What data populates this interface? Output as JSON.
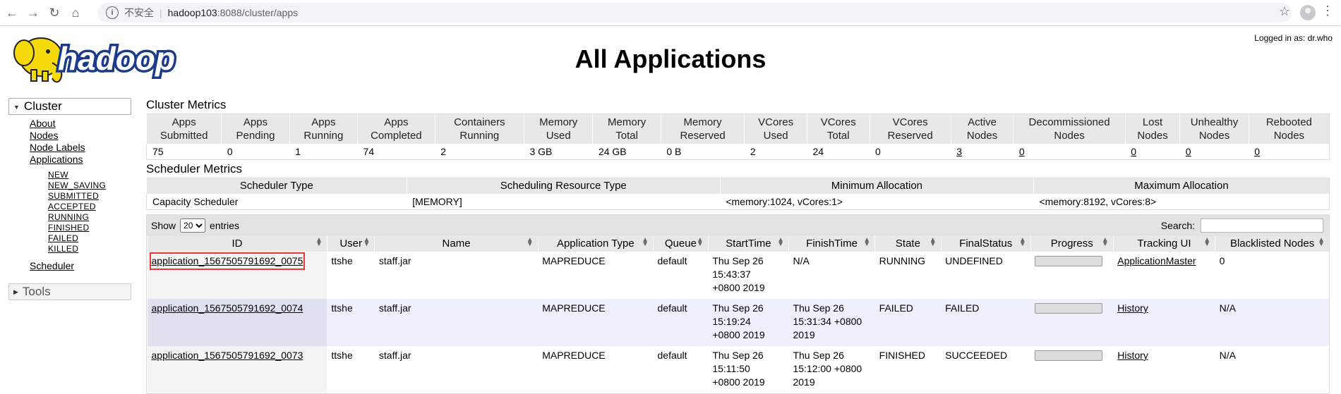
{
  "browser": {
    "insecure_label": "不安全",
    "url_host": "hadoop103",
    "url_rest": ":8088/cluster/apps"
  },
  "header": {
    "logo_text": "hadoop",
    "title": "All Applications",
    "logged_in": "Logged in as: dr.who"
  },
  "sidebar": {
    "cluster_label": "Cluster",
    "links": [
      "About",
      "Nodes",
      "Node Labels",
      "Applications"
    ],
    "app_states": [
      "NEW",
      "NEW_SAVING",
      "SUBMITTED",
      "ACCEPTED",
      "RUNNING",
      "FINISHED",
      "FAILED",
      "KILLED"
    ],
    "scheduler": "Scheduler",
    "tools_label": "Tools"
  },
  "cluster_metrics": {
    "title": "Cluster Metrics",
    "headers": [
      [
        "Apps",
        "Submitted"
      ],
      [
        "Apps",
        "Pending"
      ],
      [
        "Apps",
        "Running"
      ],
      [
        "Apps",
        "Completed"
      ],
      [
        "Containers",
        "Running"
      ],
      [
        "Memory",
        "Used"
      ],
      [
        "Memory",
        "Total"
      ],
      [
        "Memory",
        "Reserved"
      ],
      [
        "VCores",
        "Used"
      ],
      [
        "VCores",
        "Total"
      ],
      [
        "VCores",
        "Reserved"
      ],
      [
        "Active",
        "Nodes"
      ],
      [
        "Decommissioned",
        "Nodes"
      ],
      [
        "Lost",
        "Nodes"
      ],
      [
        "Unhealthy",
        "Nodes"
      ],
      [
        "Rebooted",
        "Nodes"
      ]
    ],
    "values": [
      "75",
      "0",
      "1",
      "74",
      "2",
      "3 GB",
      "24 GB",
      "0 B",
      "2",
      "24",
      "0",
      "3",
      "0",
      "0",
      "0",
      "0"
    ]
  },
  "scheduler_metrics": {
    "title": "Scheduler Metrics",
    "headers": [
      "Scheduler Type",
      "Scheduling Resource Type",
      "Minimum Allocation",
      "Maximum Allocation"
    ],
    "values": [
      "Capacity Scheduler",
      "[MEMORY]",
      "<memory:1024, vCores:1>",
      "<memory:8192, vCores:8>"
    ]
  },
  "apps_table": {
    "show_label": "Show",
    "entries_value": "20",
    "entries_label": "entries",
    "search_label": "Search:",
    "search_value": "",
    "columns": [
      "ID",
      "User",
      "Name",
      "Application Type",
      "Queue",
      "StartTime",
      "FinishTime",
      "State",
      "FinalStatus",
      "Progress",
      "Tracking UI",
      "Blacklisted Nodes"
    ],
    "rows": [
      {
        "id": "application_1567505791692_0075",
        "user": "ttshe",
        "name": "staff.jar",
        "type": "MAPREDUCE",
        "queue": "default",
        "start": [
          "Thu Sep 26",
          "15:43:37",
          "+0800 2019"
        ],
        "finish": [
          "N/A"
        ],
        "state": "RUNNING",
        "final": "UNDEFINED",
        "progress": 0,
        "tracking": "ApplicationMaster",
        "blacklisted": "0"
      },
      {
        "id": "application_1567505791692_0074",
        "user": "ttshe",
        "name": "staff.jar",
        "type": "MAPREDUCE",
        "queue": "default",
        "start": [
          "Thu Sep 26",
          "15:19:24",
          "+0800 2019"
        ],
        "finish": [
          "Thu Sep 26",
          "15:31:34 +0800",
          "2019"
        ],
        "state": "FAILED",
        "final": "FAILED",
        "progress": 0,
        "tracking": "History",
        "blacklisted": "N/A"
      },
      {
        "id": "application_1567505791692_0073",
        "user": "ttshe",
        "name": "staff.jar",
        "type": "MAPREDUCE",
        "queue": "default",
        "start": [
          "Thu Sep 26",
          "15:11:50",
          "+0800 2019"
        ],
        "finish": [
          "Thu Sep 26",
          "15:12:00 +0800",
          "2019"
        ],
        "state": "FINISHED",
        "final": "SUCCEEDED",
        "progress": 0,
        "tracking": "History",
        "blacklisted": "N/A"
      }
    ]
  },
  "colors": {
    "highlight_box": "#e53935",
    "row_alt": "#eef0fb",
    "header_bg": "#e8e8e8"
  }
}
